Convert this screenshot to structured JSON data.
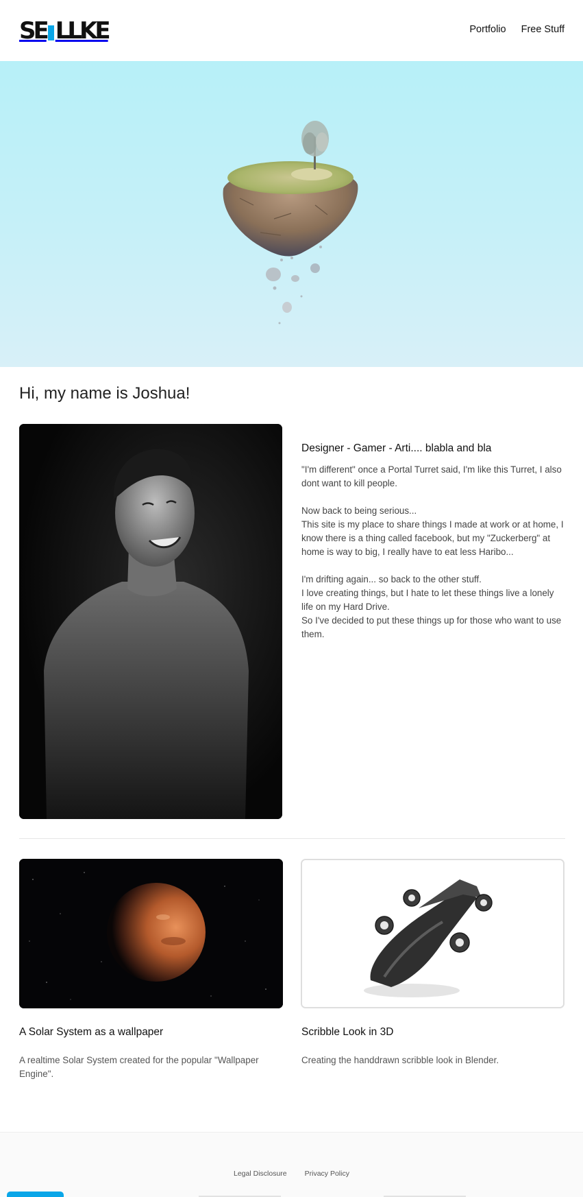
{
  "header": {
    "logo_text": "SELLKE",
    "nav": [
      {
        "label": "Portfolio"
      },
      {
        "label": "Free Stuff"
      }
    ]
  },
  "hero": {
    "image": "floating-island-illustration"
  },
  "intro": {
    "title": "Hi, my name is Joshua!",
    "portrait": "smiling-man-portrait-photo",
    "subtitle": "Designer - Gamer - Arti.... blabla and bla",
    "body": "\"I'm different\" once a Portal Turret said, I'm like this Turret, I also dont want to kill people.\n\nNow back to being serious...\nThis site is my place to share things I made at work or at home, I know there is a thing called facebook, but my \"Zuckerberg\" at home is way to big, I really have to eat less Haribo...\n\nI'm drifting again... so back to the other stuff.\nI love creating things, but I hate to let these things live a lonely life on my Hard Drive.\nSo I've decided to put these things up for those who want to use them."
  },
  "projects": [
    {
      "title": "A Solar System as a wallpaper",
      "description": "A realtime Solar System created for the popular \"Wallpaper Engine\".",
      "image": "mars-planet-image"
    },
    {
      "title": "Scribble Look in 3D",
      "description": "Creating the handdrawn scribble look in Blender.",
      "image": "3d-spaceship-render"
    }
  ],
  "footer": {
    "links": [
      {
        "label": "Legal Disclosure"
      },
      {
        "label": "Privacy Policy"
      }
    ]
  },
  "colors": {
    "accent": "#0aa6e8",
    "hero_sky": "#b7f0f8",
    "text": "#222222"
  }
}
